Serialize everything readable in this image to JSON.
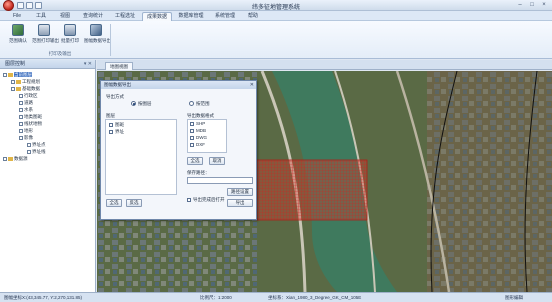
{
  "window": {
    "title": "纬多征地管理系统"
  },
  "menu": {
    "tabs": [
      {
        "label": "File",
        "active": false
      },
      {
        "label": "工具",
        "active": false
      },
      {
        "label": "视图",
        "active": false
      },
      {
        "label": "查询统计",
        "active": false
      },
      {
        "label": "工程选址",
        "active": false
      },
      {
        "label": "成果数据",
        "active": true
      },
      {
        "label": "数据库管理",
        "active": false
      },
      {
        "label": "系统管理",
        "active": false
      },
      {
        "label": "帮助",
        "active": false
      }
    ]
  },
  "ribbon": {
    "buttons": [
      {
        "label": "范围确认"
      },
      {
        "label": "范围打印输出"
      },
      {
        "label": "批量打印"
      },
      {
        "label": "图幅数据导出"
      }
    ],
    "group_label": "打印及输出"
  },
  "tree": {
    "title": "图层控制",
    "nodes": [
      {
        "label": "当前图层",
        "level": 0,
        "selected": true
      },
      {
        "label": "工程规划",
        "level": 1
      },
      {
        "label": "基础数据",
        "level": 1
      },
      {
        "label": "行政区",
        "level": 2
      },
      {
        "label": "道路",
        "level": 2
      },
      {
        "label": "水系",
        "level": 2
      },
      {
        "label": "地类图斑",
        "level": 2
      },
      {
        "label": "线状地物",
        "level": 2
      },
      {
        "label": "地形",
        "level": 2
      },
      {
        "label": "影像",
        "level": 2
      },
      {
        "label": "界址点",
        "level": 3
      },
      {
        "label": "界址线",
        "level": 3
      },
      {
        "label": "数据源",
        "level": 0
      }
    ]
  },
  "map": {
    "tab_label": "地图视图"
  },
  "dialog": {
    "title": "图幅数据导出",
    "mode_label": "导出方式",
    "radio_all": "按图层",
    "radio_range": "按范围",
    "left_group_label": "图层",
    "layer_items": [
      "图斑",
      "界址"
    ],
    "format_label": "导出数据格式",
    "formats": [
      "SHP",
      "MDB",
      "DWG",
      "DXF"
    ],
    "btn_all": "全选",
    "btn_invert": "反选",
    "btn_select_all": "全选",
    "btn_clear": "取消",
    "path_label": "保存路径：",
    "path_value": "",
    "btn_browse": "路径设置",
    "check_open": "导出完成后打开",
    "btn_export": "导出"
  },
  "status": {
    "coords": "图幅坐标X:(43,345.77, Y:2,270,131.85)",
    "scale": "比例尺：1:2000",
    "srs": "坐标系：Xian_1980_3_Degree_GK_CM_105E",
    "mode": "图形编辑"
  },
  "colors": {
    "selection_fill": "#d9362f",
    "accent": "#3a6dbf"
  }
}
